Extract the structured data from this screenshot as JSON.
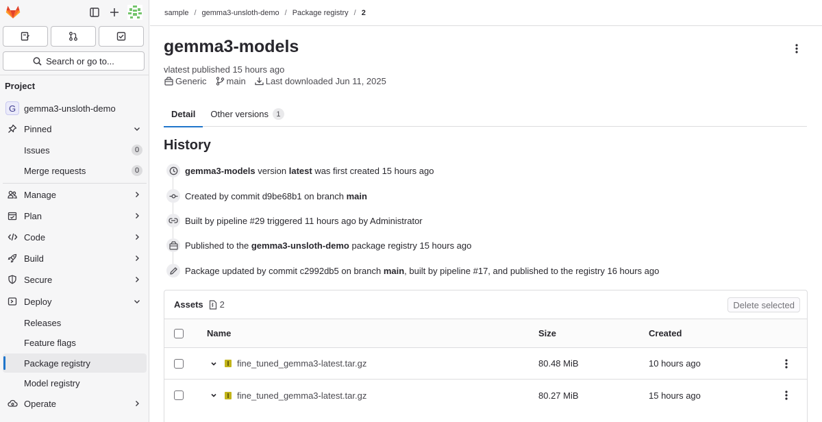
{
  "colors": {
    "accent": "#1f75cb",
    "logo_orange": "#e24329"
  },
  "sidebar": {
    "top_buttons": [
      "issues-icon",
      "merge-request-icon",
      "todo-icon"
    ],
    "search_placeholder": "Search or go to...",
    "section_title": "Project",
    "project": {
      "initial": "G",
      "name": "gemma3-unsloth-demo"
    },
    "pinned": {
      "label": "Pinned",
      "items": [
        {
          "label": "Issues",
          "count": "0"
        },
        {
          "label": "Merge requests",
          "count": "0"
        }
      ]
    },
    "menu": [
      {
        "label": "Manage",
        "icon": "users-icon"
      },
      {
        "label": "Plan",
        "icon": "plan-icon"
      },
      {
        "label": "Code",
        "icon": "code-icon"
      },
      {
        "label": "Build",
        "icon": "rocket-icon"
      },
      {
        "label": "Secure",
        "icon": "shield-icon"
      }
    ],
    "deploy": {
      "label": "Deploy",
      "items": [
        "Releases",
        "Feature flags",
        "Package registry",
        "Model registry"
      ]
    },
    "operate": "Operate"
  },
  "breadcrumb": [
    "sample",
    "gemma3-unsloth-demo",
    "Package registry",
    "2"
  ],
  "package": {
    "title": "gemma3-models",
    "published": "vlatest published 15 hours ago",
    "type": "Generic",
    "branch": "main",
    "last_downloaded": "Last downloaded Jun 11, 2025"
  },
  "tabs": {
    "detail": "Detail",
    "other_versions": "Other versions",
    "other_versions_count": "1"
  },
  "history": {
    "title": "History",
    "items": [
      {
        "pre": "",
        "b1": "gemma3-models",
        "mid": " version ",
        "b2": "latest",
        "post": " was first created 15 hours ago"
      },
      {
        "pre": "Created by commit d9be68b1 on branch ",
        "b1": "main",
        "mid": "",
        "b2": "",
        "post": ""
      },
      {
        "pre": "Built by pipeline #29 triggered 11 hours ago by Administrator",
        "b1": "",
        "mid": "",
        "b2": "",
        "post": ""
      },
      {
        "pre": "Published to the ",
        "b1": "gemma3-unsloth-demo",
        "mid": " package registry 15 hours ago",
        "b2": "",
        "post": ""
      },
      {
        "pre": "Package updated by commit c2992db5 on branch ",
        "b1": "main",
        "mid": ", built by pipeline #17, and published to the registry 16 hours ago",
        "b2": "",
        "post": ""
      }
    ]
  },
  "assets": {
    "title": "Assets",
    "count": "2",
    "delete_label": "Delete selected",
    "columns": {
      "name": "Name",
      "size": "Size",
      "created": "Created"
    },
    "rows": [
      {
        "name": "fine_tuned_gemma3-latest.tar.gz",
        "size": "80.48 MiB",
        "created": "10 hours ago"
      },
      {
        "name": "fine_tuned_gemma3-latest.tar.gz",
        "size": "80.27 MiB",
        "created": "15 hours ago"
      }
    ]
  }
}
